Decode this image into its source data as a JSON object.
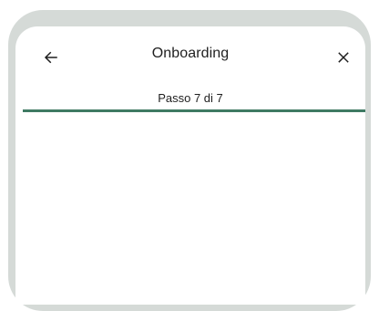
{
  "header": {
    "title": "Onboarding",
    "back_icon": "arrow-left-icon",
    "close_icon": "close-icon"
  },
  "progress": {
    "label": "Passo 7 di 7",
    "current_step": 7,
    "total_steps": 7,
    "fraction": 1.0,
    "color": "#3f7a63"
  }
}
